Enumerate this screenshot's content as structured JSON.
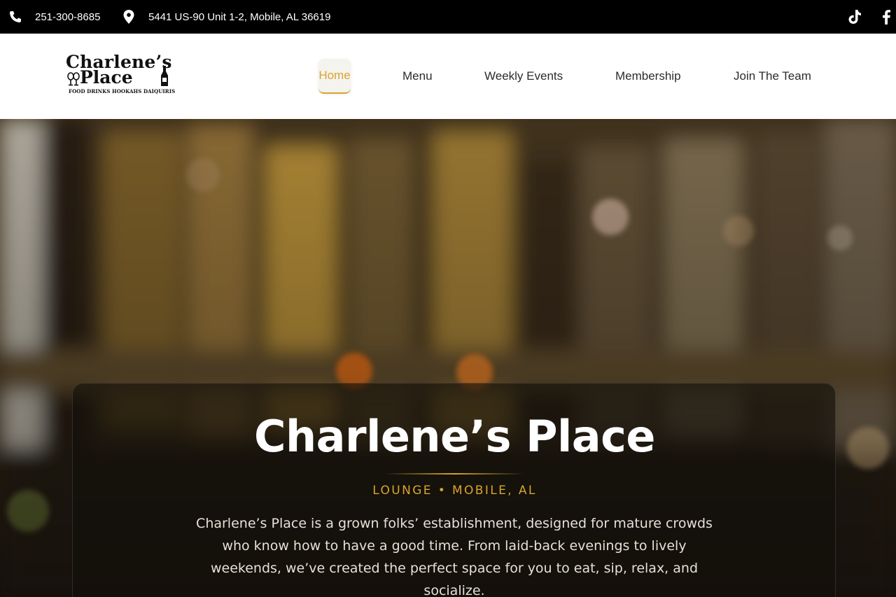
{
  "topbar": {
    "phone": "251-300-8685",
    "address": "5441 US-90 Unit 1-2, Mobile, AL 36619",
    "icons": [
      "phone-icon",
      "map-pin-icon",
      "tiktok-icon",
      "facebook-icon"
    ]
  },
  "header": {
    "logo": {
      "text": "Charlene's Place",
      "tagline": "FOOD DRINKS HOOKAHS DAIQUIRIS"
    },
    "nav": [
      {
        "label": "Home",
        "active": true
      },
      {
        "label": "Menu"
      },
      {
        "label": "Weekly Events"
      },
      {
        "label": "Membership"
      },
      {
        "label": "Join The Team"
      }
    ]
  },
  "hero": {
    "title": "Charlene’s Place",
    "subtitle": "LOUNGE • MOBILE, AL",
    "description": "Charlene’s Place is a grown folks’ establishment, designed for mature crowds who know how to have a good time. From laid-back evenings to lively weekends, we’ve created the perfect space for you to eat, sip, relax, and socialize."
  },
  "colors": {
    "accent": "#d9a52c",
    "topbar_bg": "#000000",
    "header_bg": "#ffffff",
    "nav_text": "#2b2b2b"
  }
}
